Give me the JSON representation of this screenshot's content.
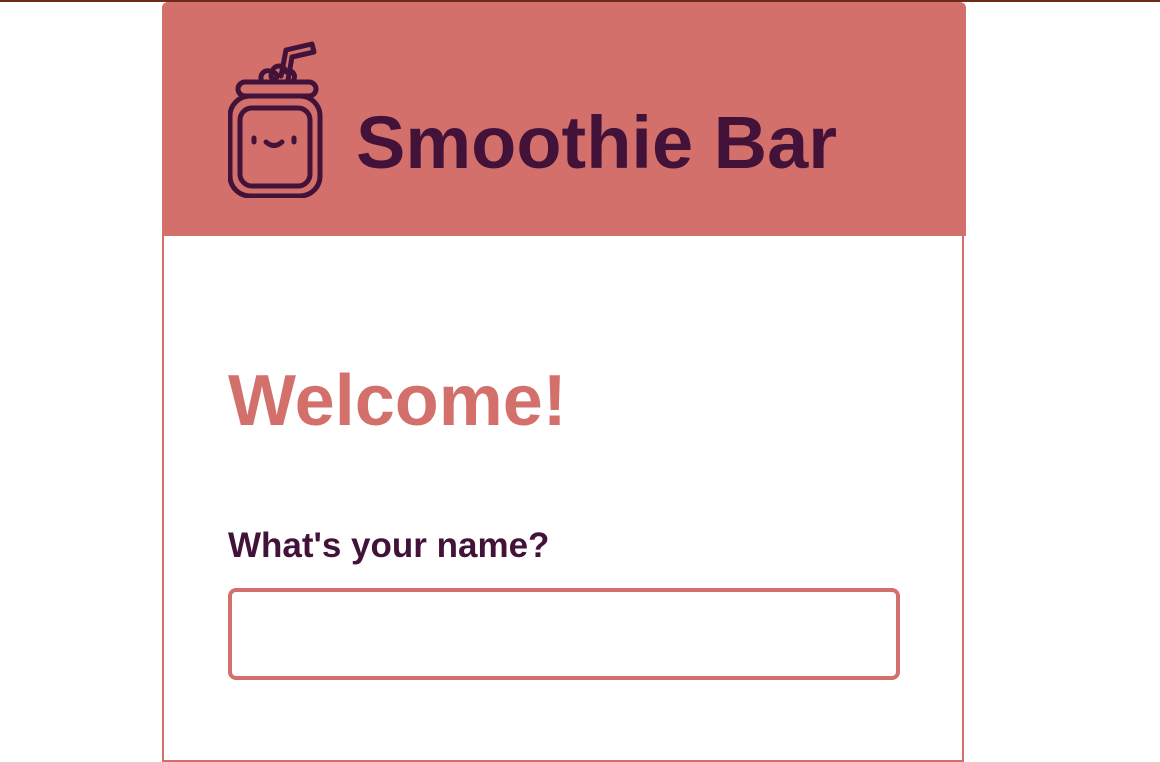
{
  "header": {
    "brand_title": "Smoothie Bar",
    "logo_icon": "smoothie-jar-icon"
  },
  "main": {
    "welcome_heading": "Welcome!",
    "name_label": "What's your name?",
    "name_input_value": "",
    "name_input_placeholder": ""
  },
  "colors": {
    "brand_coral": "#d4706c",
    "text_plum": "#421239",
    "top_rule": "#6b2a1a",
    "background": "#ffffff"
  }
}
